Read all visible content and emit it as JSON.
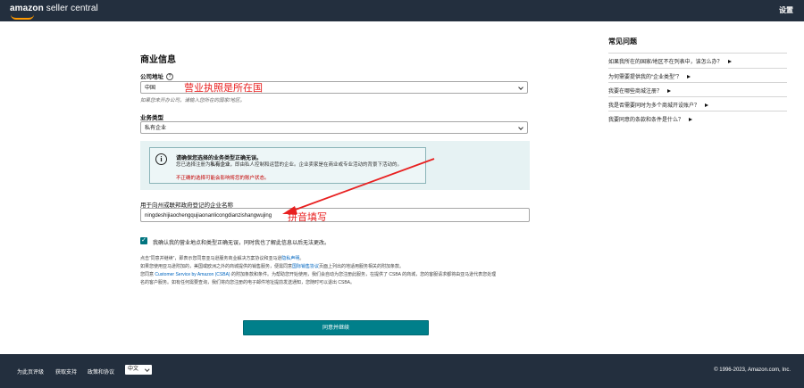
{
  "header": {
    "logo_brand": "amazon",
    "logo_suffix": " seller central",
    "settings_label": "设置"
  },
  "form": {
    "title": "商业信息",
    "company_address_label": "公司地址",
    "company_address_value": "中国",
    "company_address_hint": "如果您未开办公司，请输入您所在的国家/地区。",
    "business_type_label": "业务类型",
    "business_type_value": "私有企业",
    "info_title": "请确保您选择的业务类型正确无误。",
    "info_body_prefix": "您已选择注册为",
    "info_body_bold": "私有企业",
    "info_body_suffix": "，即由私人控制和运营的企业。企业卖家是在商业或专业活动的背景下活动的。",
    "info_warning": "不正确的选择可能会影响将您的账户状态。",
    "company_name_label": "用于向州或联邦政府登记的企业名称",
    "company_name_value": "ningdeshijiaochengqujiaonanlicongdianzishangwujing",
    "confirm_label": "我确认我的营业地点和类型正确无误，同时我也了解此信息以后无法更改。",
    "legal_line1_prefix": "点击“同意并继续”，即表示您同意亚马逊服务商业解决方案协议和亚马逊",
    "legal_line1_link": "隐私声明",
    "legal_line1_suffix": "。",
    "legal_line2_prefix": "如果您使用亚马逊附加的，美国或欧洲之外的商城提供的销售服务，便需同意",
    "legal_line2_link": "国际销售协议",
    "legal_line2_suffix": "页面上列出的地适用服务相关的附加条款。",
    "legal_line3_prefix": "您同意 ",
    "legal_line3_link": "Customer Service by Amazon (CSBA)",
    "legal_line3_suffix": " 的附加条款和条件。为帮助您开始使用，我们会自动为您注册此服务，在提供了 CSBA 的商城，您的客服请求都将由亚马逊代表您处理",
    "legal_line4": "名的客户服务。如有任何需要查询，我们将向您注册的电子邮件地址提前发送通知，您随时可以退出 CSBA。",
    "agree_button": "同意并继续"
  },
  "annotations": {
    "country_note": "营业执照是所在国",
    "pinyin_note": "拼音填写"
  },
  "faq": {
    "title": "常见问题",
    "items": [
      "如果我所在的国家/地区不在列表中，该怎么办？",
      "为何需要提供我的“企业类型”？",
      "我要在哪些商城注册？",
      "我是否需要同时为多个商城开设账户？",
      "我要同意的条款和条件是什么？"
    ]
  },
  "footer": {
    "links": [
      "为此页评级",
      "获取支持",
      "政策和协议"
    ],
    "language": "中文",
    "copyright": "© 1996-2023, Amazon.com, Inc."
  },
  "colors": {
    "header_bg": "#232f3e",
    "primary_button": "#007f8a",
    "annotation": "#e82020",
    "info_bg": "#e6f2f3"
  }
}
